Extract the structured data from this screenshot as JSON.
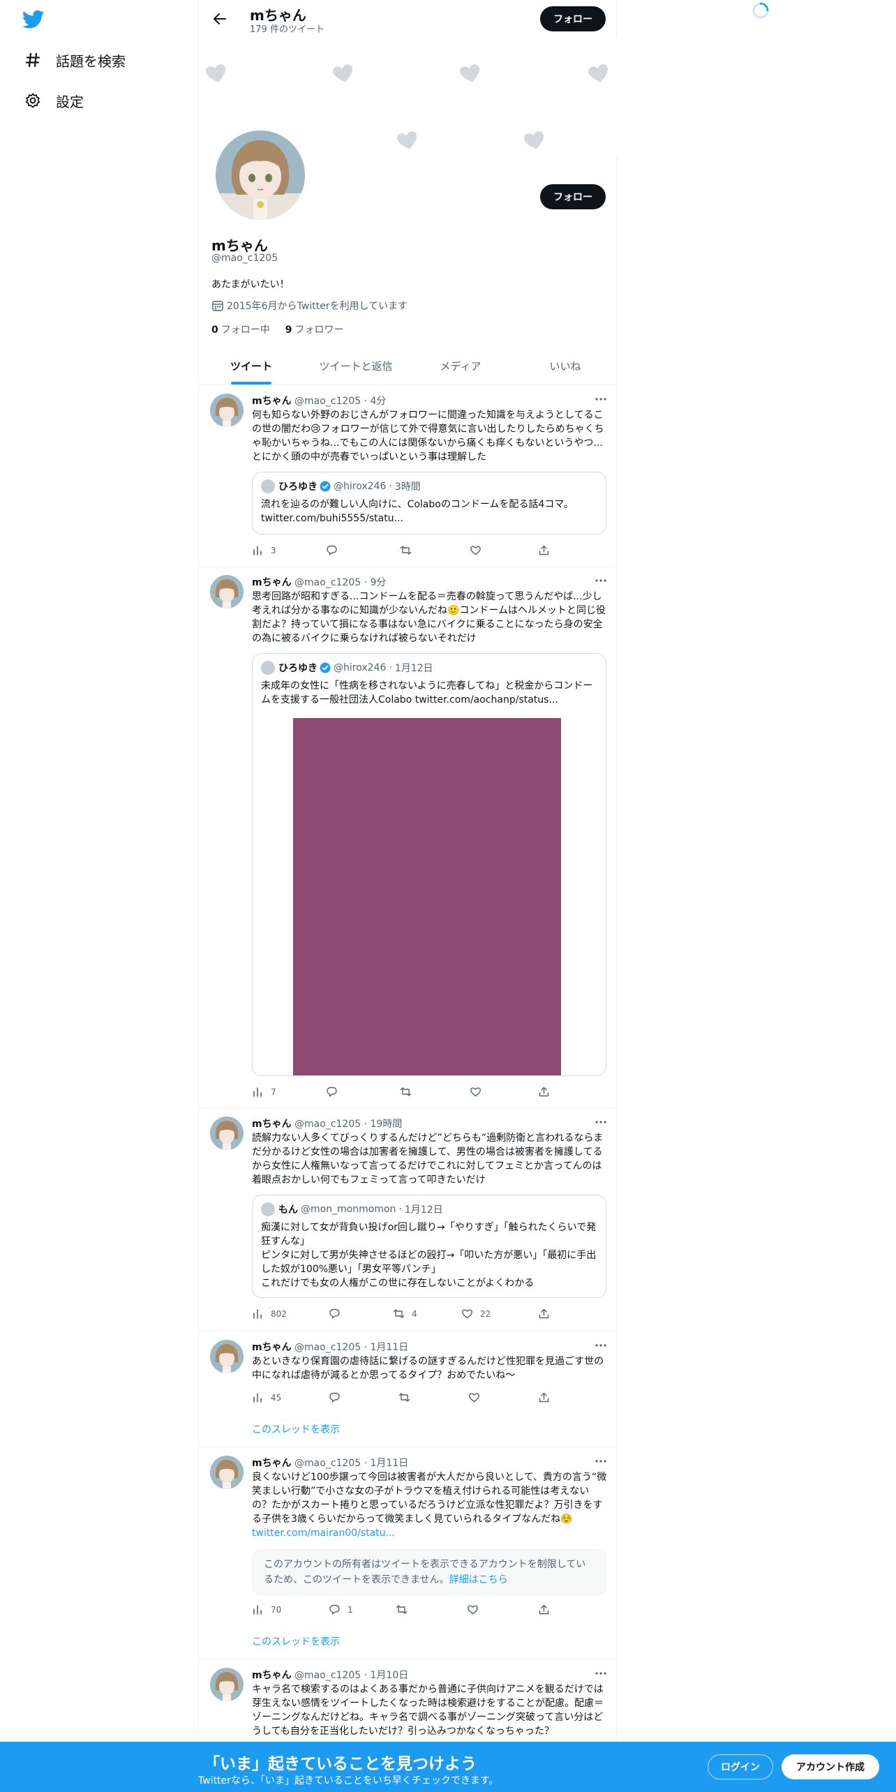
{
  "nav": {
    "explore_label": "話題を検索",
    "settings_label": "設定"
  },
  "header": {
    "name": "mちゃん",
    "tweet_count": "179 件のツイート",
    "follow_label": "フォロー"
  },
  "profile": {
    "name": "mちゃん",
    "handle": "@mao_c1205",
    "bio": "あたまがいたい！",
    "joined": "2015年6月からTwitterを利用しています",
    "following_count": "0",
    "following_label": "フォロー中",
    "followers_count": "9",
    "followers_label": "フォロワー",
    "follow_label": "フォロー"
  },
  "tabs": [
    {
      "label": "ツイート"
    },
    {
      "label": "ツイートと返信"
    },
    {
      "label": "メディア"
    },
    {
      "label": "いいね"
    }
  ],
  "tweets": [
    {
      "name": "mちゃん",
      "handle": "@mao_c1205",
      "time": "4分",
      "text": "何も知らない外野のおじさんがフォロワーに間違った知識を与えようとしてるこの世の闇だわ😢フォロワーが信じて外で得意気に言い出したりしたらめちゃくちゃ恥かいちゃうね...でもこの人には関係ないから痛くも痒くもないというやつ...とにかく頭の中が売春でいっぱいという事は理解した",
      "quote": {
        "name": "ひろゆき",
        "handle": "@hirox246",
        "time": "3時間",
        "text": "流れを辿るのが難しい人向けに、Colaboのコンドームを配る話4コマ。 twitter.com/buhi5555/statu..."
      },
      "stats": {
        "views": "3",
        "replies": "",
        "retweets": "",
        "likes": ""
      }
    },
    {
      "name": "mちゃん",
      "handle": "@mao_c1205",
      "time": "9分",
      "text": "思考回路が昭和すぎる...コンドームを配る＝売春の斡旋って思うんだやば...少し考えれば分かる事なのに知識が少ないんだね🙂コンドームはヘルメットと同じ役割だよ？持っていて損になる事はない急にバイクに乗ることになったら身の安全の為に被るバイクに乗らなければ被らないそれだけ",
      "quote": {
        "name": "ひろゆき",
        "handle": "@hirox246",
        "time": "1月12日",
        "text": "未成年の女性に「性病を移されないように売春してね」と税金からコンドームを支援する一般社団法人Colabo  twitter.com/aochanp/status..."
      },
      "stats": {
        "views": "7",
        "replies": "",
        "retweets": "",
        "likes": ""
      }
    },
    {
      "name": "mちゃん",
      "handle": "@mao_c1205",
      "time": "19時間",
      "text": "読解力ない人多くてびっくりするんだけど”どちらも”過剰防衛と言われるならまだ分かるけど女性の場合は加害者を擁護して、男性の場合は被害者を擁護してるから女性に人権無いなって言ってるだけでこれに対してフェミとか言ってんのは着眼点おかしい何でもフェミって言って叩きたいだけ",
      "quote": {
        "name": "もん",
        "handle": "@mon_monmomon",
        "time": "1月12日",
        "text": "痴漢に対して女が背負い投げor回し蹴り→「やりすぎ」「触られたくらいで発狂すんな」\nピンタに対して男が失神させるほどの殴打→「叩いた方が悪い」「最初に手出した奴が100%悪い」「男女平等パンチ」\nこれだけでも女の人権がこの世に存在しないことがよくわかる"
      },
      "stats": {
        "views": "802",
        "replies": "",
        "retweets": "4",
        "likes": "22"
      }
    },
    {
      "name": "mちゃん",
      "handle": "@mao_c1205",
      "time": "1月11日",
      "text": "あといきなり保育園の虐待話に繋げるの謎すぎるんだけど性犯罪を見過ごす世の中になれば虐待が減るとか思ってるタイプ？おめでたいね〜",
      "stats": {
        "views": "45",
        "replies": "",
        "retweets": "",
        "likes": ""
      },
      "thread_label": "このスレッドを表示"
    },
    {
      "name": "mちゃん",
      "handle": "@mao_c1205",
      "time": "1月11日",
      "text": "良くないけど100歩譲って今回は被害者が大人だから良いとして、貴方の言う“微笑ましい行動”で小さな女の子がトラウマを植え付けられる可能性は考えないの？たかがスカート捲りと思っているだろうけど立派な性犯罪だよ？万引きをする子供を3歳くらいだからって微笑ましく見ていられるタイプなんだね☺️",
      "link": "twitter.com/mairan00/statu...",
      "restricted": "このアカウントの所有者はツイートを表示できるアカウントを制限しているため、このツイートを表示できません。",
      "restricted_link": "詳細はこちら",
      "stats": {
        "views": "70",
        "replies": "1",
        "retweets": "",
        "likes": ""
      },
      "thread_label": "このスレッドを表示"
    },
    {
      "name": "mちゃん",
      "handle": "@mao_c1205",
      "time": "1月10日",
      "text": "キャラ名で検索するのはよくある事だから普通に子供向けアニメを観るだけでは芽生えない感情をツイートしたくなった時は検索避けをすることが配慮。配慮＝ゾーニングなんだけどね。キャラ名で調べる事がゾーニング突破って言い分はどうしても自分を正当化したいだけ？引っ込みつかなくなっちゃった？"
    }
  ],
  "bottom_bar": {
    "title": "「いま」起きていることを見つけよう",
    "subtitle": "Twitterなら、「いま」起きていることをいち早くチェックできます。",
    "login_label": "ログイン",
    "signup_label": "アカウント作成"
  },
  "colors": {
    "accent": "#1d9bf0",
    "text": "#0f1419",
    "muted": "#536471",
    "media": "#8d4a70"
  }
}
